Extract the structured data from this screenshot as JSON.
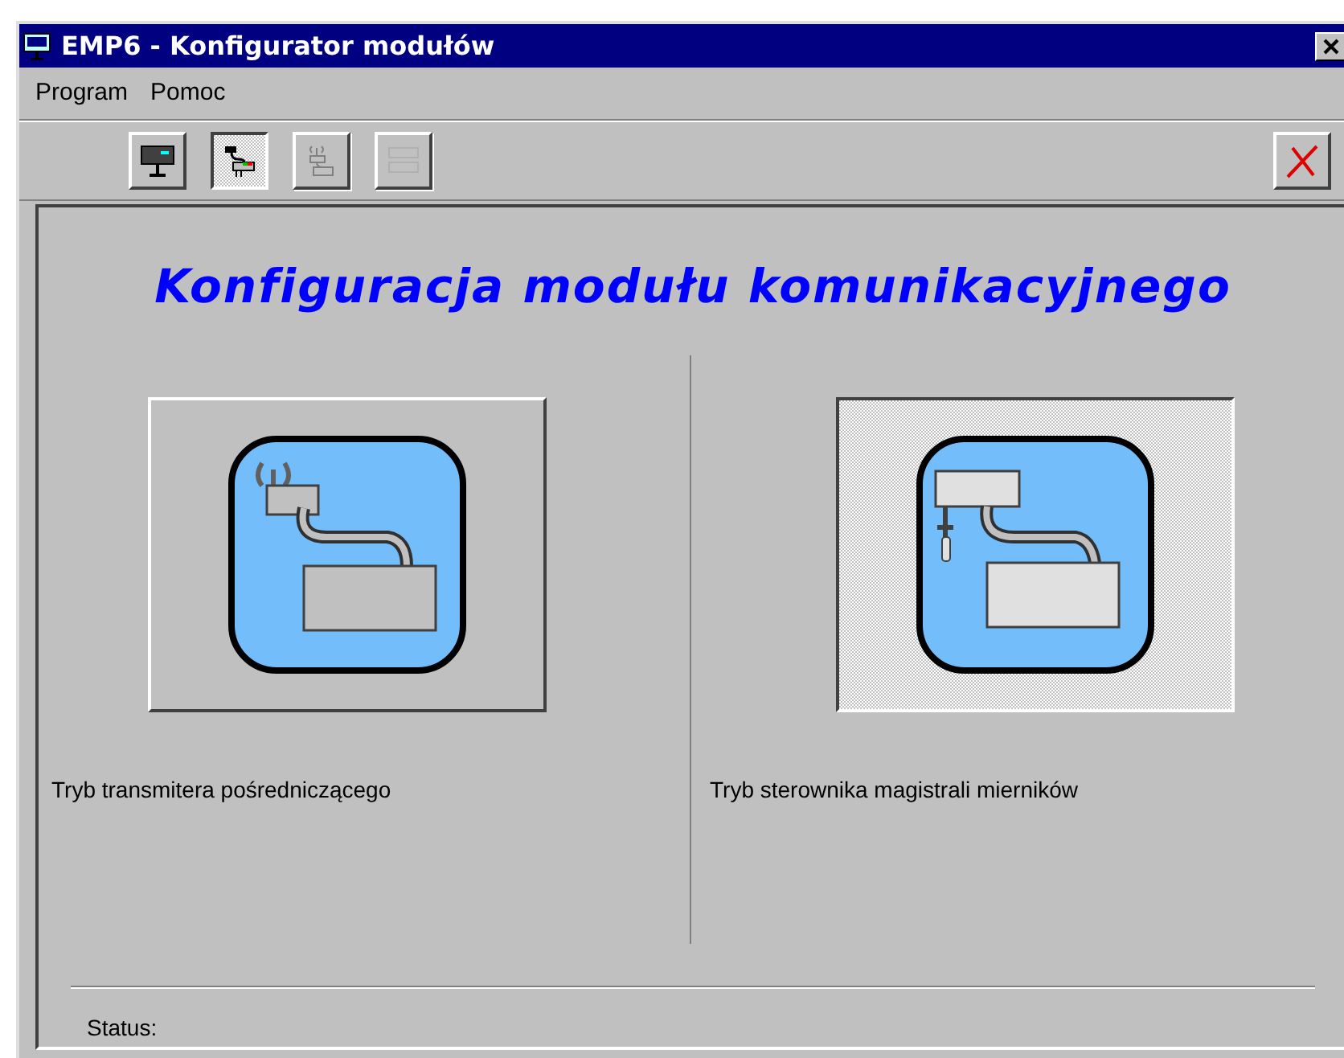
{
  "window": {
    "title": "EMP6 - Konfigurator modułów"
  },
  "menu": [
    {
      "label": "Program"
    },
    {
      "label": "Pomoc"
    }
  ],
  "toolbar": [
    {
      "kind": "monitor",
      "selected": false,
      "disabled": false
    },
    {
      "kind": "wired",
      "selected": true,
      "disabled": false
    },
    {
      "kind": "radio",
      "selected": false,
      "disabled": true
    },
    {
      "kind": "list",
      "selected": false,
      "disabled": true
    }
  ],
  "heading": "Konfiguracja modułu komunikacyjnego",
  "modes": [
    {
      "kind": "radio",
      "label": "Tryb transmitera pośredniczącego",
      "selected": false
    },
    {
      "kind": "wired",
      "label": "Tryb sterownika magistrali mierników",
      "selected": true
    }
  ],
  "status": {
    "label": "Status:"
  }
}
